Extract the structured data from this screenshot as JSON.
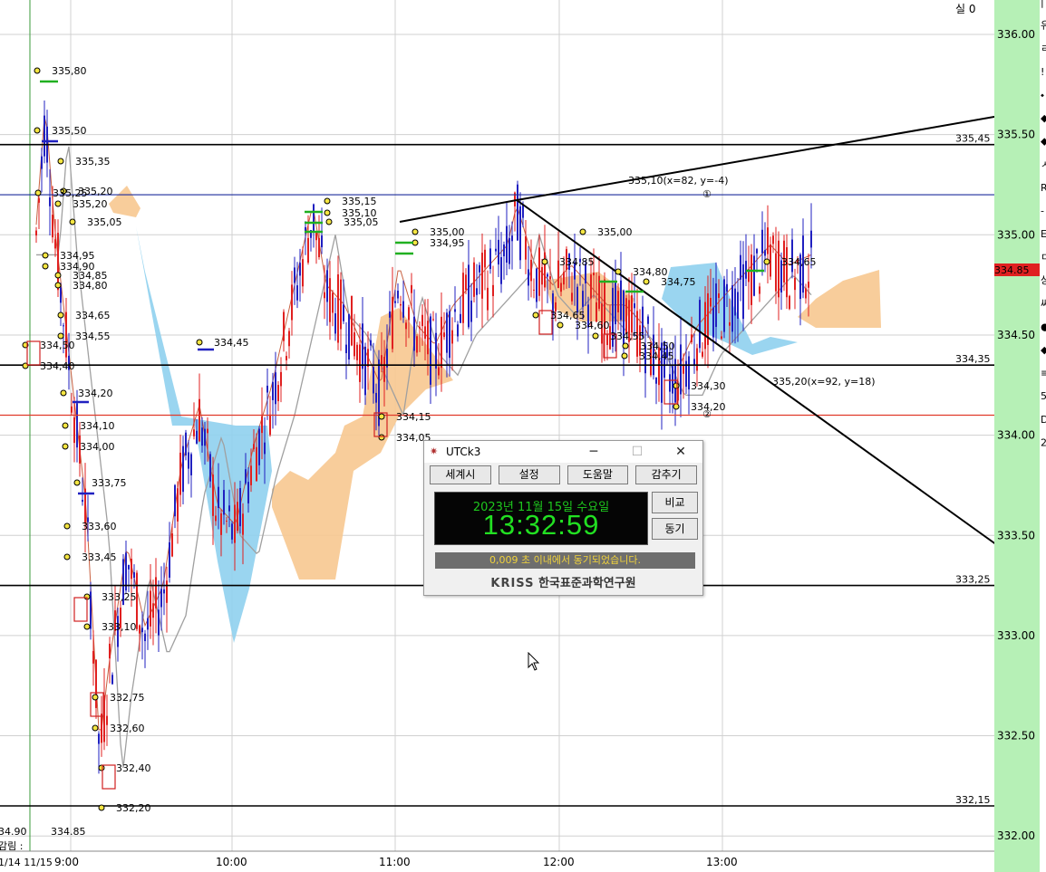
{
  "top_right_label": "실 0",
  "dates_label": "1/14  11/15",
  "bottom_left_label": "감림 :",
  "bottom_left_values": [
    "34.90",
    "334.85"
  ],
  "current_price_tag": "334.85",
  "colors": {
    "bull": "#e02020",
    "bear": "#2020c0",
    "cloud_blue": "#8fd0ee",
    "cloud_orange": "#f7c890",
    "hline": "#000000",
    "blue_line": "#1c2c9c",
    "red_line": "#e03a2a",
    "axis_green": "#b6f0b6",
    "clock_bg": "#050505",
    "clock_fg": "#22e022",
    "status_fg": "#f0d23c"
  },
  "right_edge_glyphs": [
    "|",
    "유",
    "ㄹ",
    "!",
    "⬩",
    "◆",
    "◆",
    "ㅅ",
    "R",
    "-",
    "E",
    "ㅁ",
    "상",
    "싸",
    "●",
    "◆",
    "≡",
    "5",
    "D",
    "2"
  ],
  "chart_data": {
    "type": "candlestick",
    "x_tick_labels": [
      "9:00",
      "10:00",
      "11:00",
      "12:00",
      "13:00"
    ],
    "y_axis_labels": [
      "336.00",
      "335.50",
      "335.00",
      "334.50",
      "334.00",
      "333.50",
      "333.00",
      "332.50",
      "332.00"
    ],
    "ylim": [
      331.9,
      336.1
    ],
    "horizontal_lines": [
      {
        "value": 335.45,
        "label": "335,45",
        "color": "black"
      },
      {
        "value": 334.35,
        "label": "334,35",
        "color": "black"
      },
      {
        "value": 333.25,
        "label": "333,25",
        "color": "black"
      },
      {
        "value": 332.15,
        "label": "332,15",
        "color": "black"
      },
      {
        "value": 335.2,
        "label": "",
        "color": "blue"
      },
      {
        "value": 334.1,
        "label": "",
        "color": "red"
      }
    ],
    "trendline_labels": [
      "335,10(x=82, y=-4)",
      "335,20(x=92, y=18)"
    ],
    "trendline_markers": [
      "①",
      "②"
    ],
    "price_labels": [
      "335,80",
      "335,50",
      "335,35",
      "335,20",
      "335,25",
      "335,05",
      "335,20",
      "334,95",
      "334,90",
      "334,85",
      "334,80",
      "334,65",
      "334,55",
      "334,50",
      "334,40",
      "334,20",
      "334,10",
      "334,00",
      "333,75",
      "333,60",
      "333,45",
      "333,25",
      "333,10",
      "332,75",
      "332,60",
      "332,40",
      "332,20",
      "334,45",
      "335,15",
      "335,10",
      "335,05",
      "335,00",
      "334,95",
      "334,15",
      "334,05",
      "335,00",
      "334,85",
      "334,80",
      "334,75",
      "334,65",
      "334,60",
      "334,55",
      "334,50",
      "334,45",
      "334,30",
      "334,20",
      "334,65"
    ]
  },
  "utck": {
    "title": "UTCk3",
    "min_icon": "─",
    "max_icon": "☐",
    "close_icon": "✕",
    "menu": [
      "세계시",
      "설정",
      "도움말",
      "감추기"
    ],
    "date": "2023년 11월 15일 수요일",
    "time": "13:32:59",
    "compare_btn": "비교",
    "sync_btn": "동기",
    "status": "0,009 초 이내에서 동기되었습니다.",
    "logo_kriss": "KRISS",
    "logo_text": "한국표준과학연구원"
  }
}
